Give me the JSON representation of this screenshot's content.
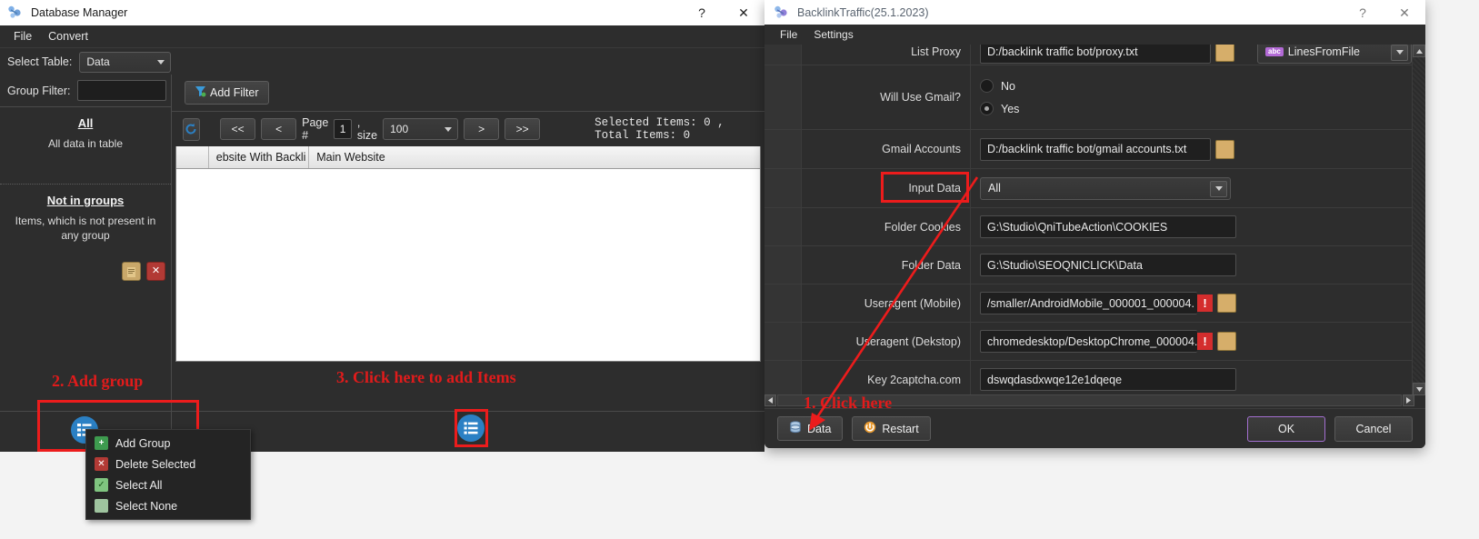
{
  "left_window": {
    "title": "Database Manager",
    "titlebar_buttons": [
      {
        "name": "help",
        "glyph": "?"
      },
      {
        "name": "close",
        "glyph": "✕"
      }
    ],
    "menu": [
      "File",
      "Convert"
    ],
    "select_table": {
      "label": "Select Table:",
      "value": "Data"
    },
    "group_filter": {
      "label": "Group Filter:",
      "value": "",
      "placeholder": ""
    },
    "groups": [
      {
        "title": "All",
        "description": "All data in table"
      },
      {
        "title": "Not in groups",
        "description": "Items, which is not present in any group"
      }
    ],
    "group_actions": [
      {
        "name": "edit-group",
        "glyph": ""
      },
      {
        "name": "delete-group",
        "glyph": "✕"
      }
    ],
    "toolbar": {
      "add_filter": "Add Filter",
      "refresh_icon": "↻"
    },
    "pagination": {
      "first": "<<",
      "prev": "<",
      "page_label": "Page #",
      "page_value": "1",
      "size_label": ", size",
      "size_value": "100",
      "next": ">",
      "last": ">>",
      "counts": "Selected Items: 0  ,  Total Items: 0"
    },
    "table": {
      "columns": [
        "",
        "ebsite With Backli",
        "Main Website"
      ],
      "rows": []
    },
    "add_group_button_icon": "list-add-icon",
    "add_items_button_icon": "list-items-icon"
  },
  "context_menu": {
    "items": [
      {
        "label": "Add Group",
        "icon": "plus-circle-icon",
        "color": "#3e9b4f"
      },
      {
        "label": "Delete Selected",
        "icon": "red-x-icon",
        "color": "#b23a35"
      },
      {
        "label": "Select All",
        "icon": "checked-grid-icon",
        "color": "#4f9a4f"
      },
      {
        "label": "Select None",
        "icon": "empty-grid-icon",
        "color": "#6f9a6f"
      }
    ]
  },
  "annotations": [
    {
      "id": "step2",
      "text": "2. Add group"
    },
    {
      "id": "step3",
      "text": "3. Click here to add Items"
    },
    {
      "id": "step1",
      "text": "1. Click here"
    }
  ],
  "right_window": {
    "title": "BacklinkTraffic(25.1.2023)",
    "titlebar_buttons": [
      {
        "name": "help",
        "glyph": "?"
      },
      {
        "name": "close",
        "glyph": "✕"
      }
    ],
    "menu": [
      "File",
      "Settings"
    ],
    "properties": [
      {
        "label": "List Proxy",
        "type": "path",
        "value": "D:/backlink traffic bot/proxy.txt",
        "has_folder_button": true,
        "extra_combo": "LinesFromFile",
        "extra_combo_tag": "abc"
      },
      {
        "label": "Will Use Gmail?",
        "type": "radio",
        "options": [
          "No",
          "Yes"
        ],
        "selected": "Yes"
      },
      {
        "label": "Gmail Accounts",
        "type": "path",
        "value": "D:/backlink traffic bot/gmail accounts.txt",
        "has_folder_button": true
      },
      {
        "label": "Input Data",
        "type": "combo",
        "value": "All",
        "highlighted": true
      },
      {
        "label": "Folder Cookies",
        "type": "text",
        "value": "G:\\Studio\\QniTubeAction\\COOKIES"
      },
      {
        "label": "Folder Data",
        "type": "text",
        "value": "G:\\Studio\\SEOQNICLICK\\Data"
      },
      {
        "label": "Useragent (Mobile)",
        "type": "path",
        "value": "/smaller/AndroidMobile_000001_000004.",
        "has_warning": true,
        "warning_glyph": "!",
        "has_folder_button": true
      },
      {
        "label": "Useragent (Dekstop)",
        "type": "path",
        "value": "chromedesktop/DesktopChrome_000004.",
        "has_warning": true,
        "warning_glyph": "!",
        "has_folder_button": true
      },
      {
        "label": "Key 2captcha.com",
        "type": "text",
        "value": "dswqdasdxwqe12e1dqeqe"
      }
    ],
    "footer": {
      "data_button": "Data",
      "restart_button": "Restart",
      "ok_button": "OK",
      "cancel_button": "Cancel"
    }
  },
  "colors": {
    "accent_blue": "#2b80c4",
    "annotation_red": "#e01b1b",
    "highlight_red": "#ec1c1c",
    "window_bg": "#2d2d2d",
    "ok_border_purple": "#a36fd0"
  }
}
